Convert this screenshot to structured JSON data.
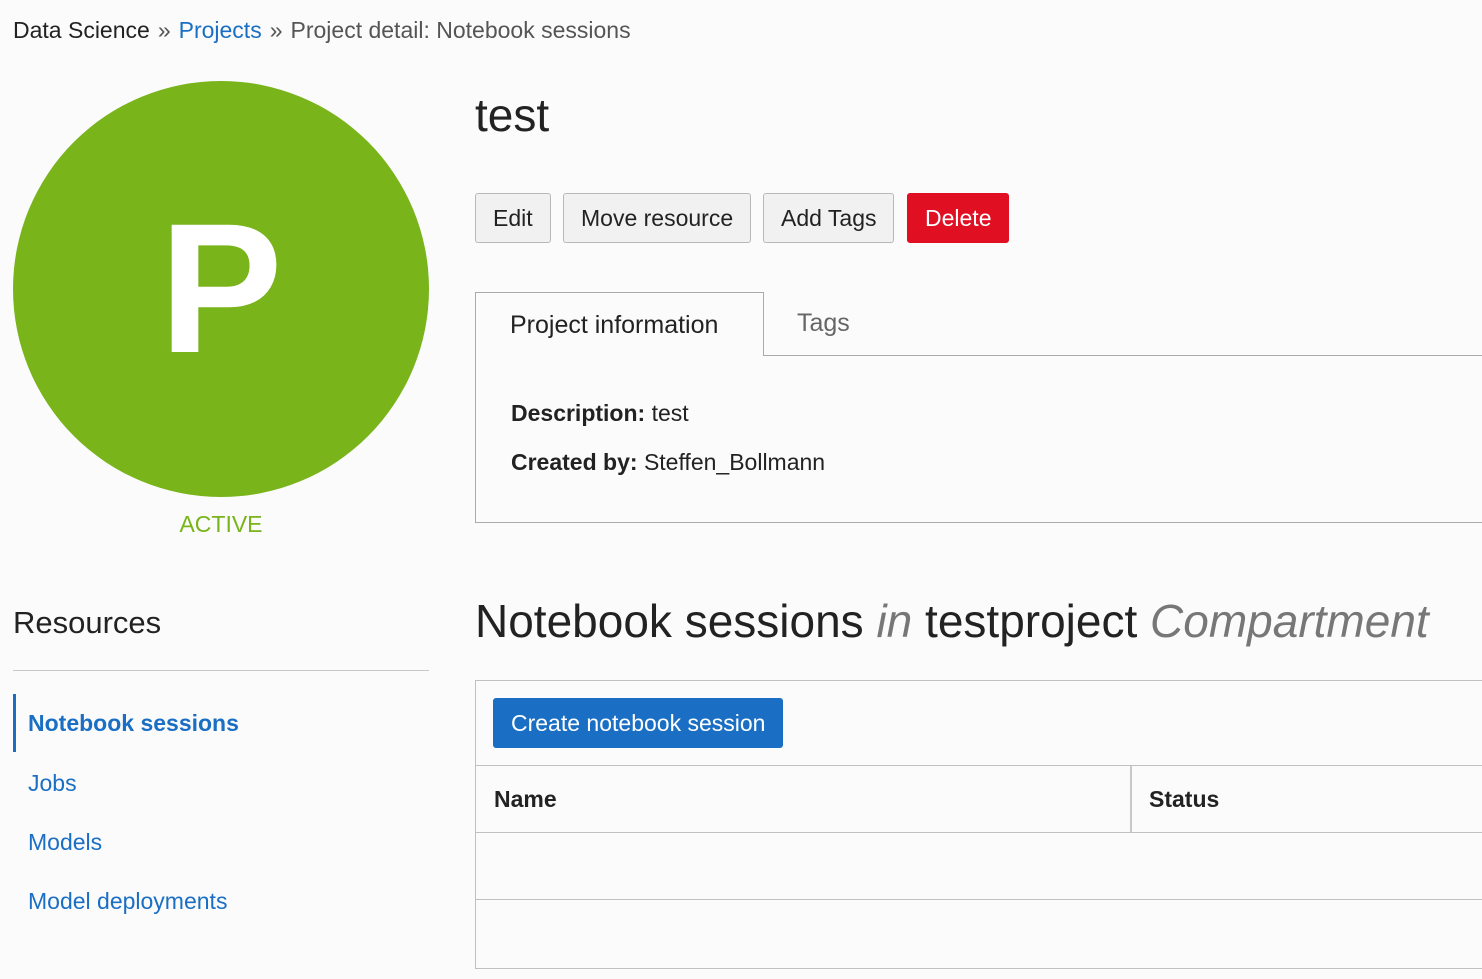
{
  "breadcrumb": {
    "root": "Data Science",
    "separator": "»",
    "link": "Projects",
    "current": "Project detail: Notebook sessions"
  },
  "project": {
    "avatar_letter": "P",
    "status": "ACTIVE",
    "title": "test",
    "accent_color": "#78b41a"
  },
  "actions": {
    "edit": "Edit",
    "move": "Move resource",
    "add_tags": "Add Tags",
    "delete": "Delete",
    "delete_color": "#e00f22"
  },
  "tabs": {
    "project_info": "Project information",
    "tags": "Tags"
  },
  "info": {
    "description_label": "Description:",
    "description_value": "test",
    "created_by_label": "Created by:",
    "created_by_value": "Steffen_Bollmann"
  },
  "resources": {
    "title": "Resources",
    "items": [
      {
        "label": "Notebook sessions",
        "active": true
      },
      {
        "label": "Jobs",
        "active": false
      },
      {
        "label": "Models",
        "active": false
      },
      {
        "label": "Model deployments",
        "active": false
      }
    ]
  },
  "section": {
    "title_main": "Notebook sessions",
    "title_in": "in",
    "compartment_name": "testproject",
    "compartment_word": "Compartment"
  },
  "table": {
    "create_button": "Create notebook session",
    "columns": [
      "Name",
      "Status"
    ],
    "link_color": "#1a6fc4"
  }
}
